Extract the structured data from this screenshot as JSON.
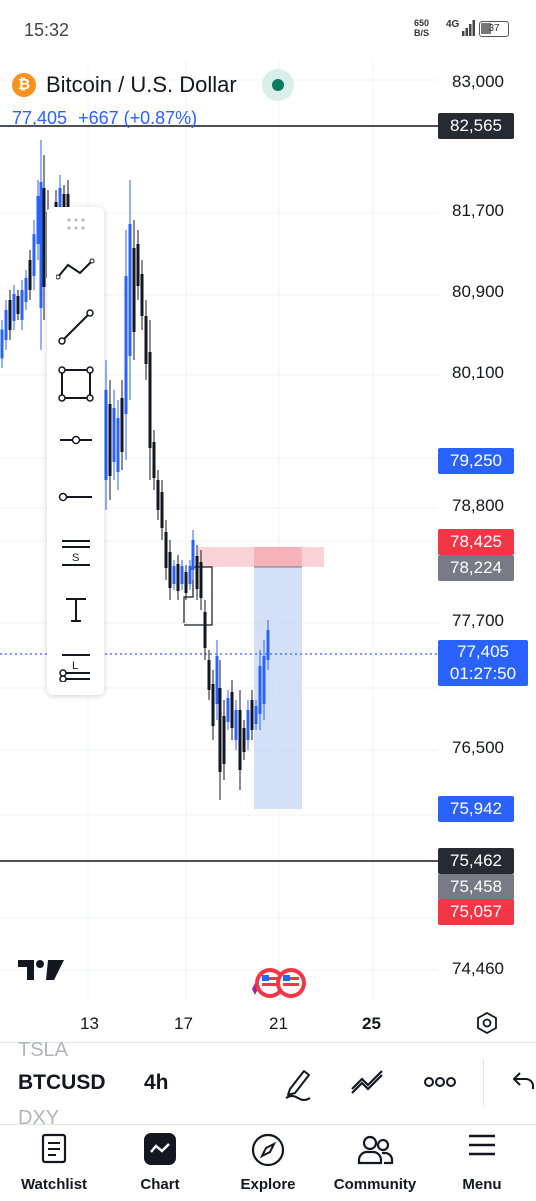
{
  "status_bar": {
    "time": "15:32",
    "net_speed_value": "650",
    "net_speed_unit": "B/S",
    "network": "4G",
    "battery": "37"
  },
  "header": {
    "title": "Bitcoin / U.S. Dollar",
    "last_price": "77,405",
    "change": "+667 (+0.87%)"
  },
  "price_axis": {
    "labels": [
      "83,000",
      "81,700",
      "80,900",
      "80,100",
      "78,800",
      "77,700",
      "76,500",
      "74,460"
    ]
  },
  "price_badges": {
    "line_high": "82,565",
    "blue_level": "79,250",
    "stop_level": "78,425",
    "entry_level": "78,224",
    "current": "77,405",
    "countdown": "01:27:50",
    "target_level": "75,942",
    "line_low": "75,462",
    "grey_level": "75,458",
    "red_low": "75,057"
  },
  "time_axis": {
    "labels": [
      "13",
      "17",
      "21",
      "25"
    ]
  },
  "drawing_tools": [
    {
      "icon": "trend-lines-icon"
    },
    {
      "icon": "trend-line-icon"
    },
    {
      "icon": "rectangle-icon"
    },
    {
      "icon": "horizontal-ray-icon"
    },
    {
      "icon": "horizontal-line-icon"
    },
    {
      "icon": "short-position-icon",
      "letter": "S"
    },
    {
      "icon": "text-icon"
    },
    {
      "icon": "long-position-icon",
      "letter": "L"
    }
  ],
  "toolbar": {
    "ticker_above": "TSLA",
    "ticker": "BTCUSD",
    "interval": "4h",
    "ticker_below": "DXY"
  },
  "nav": [
    {
      "label": "Watchlist",
      "icon": "watchlist-icon"
    },
    {
      "label": "Chart",
      "icon": "chart-icon"
    },
    {
      "label": "Explore",
      "icon": "compass-icon"
    },
    {
      "label": "Community",
      "icon": "community-icon"
    },
    {
      "label": "Menu",
      "icon": "menu-icon"
    }
  ],
  "colors": {
    "up": "#2962ff",
    "down": "#131722",
    "accent": "#2962ff",
    "stop_zone": "#f7b6bd",
    "target_zone": "#c9d8f6",
    "badge_red": "#f23645",
    "badge_grey": "#787b86",
    "badge_dark": "#262b33"
  }
}
